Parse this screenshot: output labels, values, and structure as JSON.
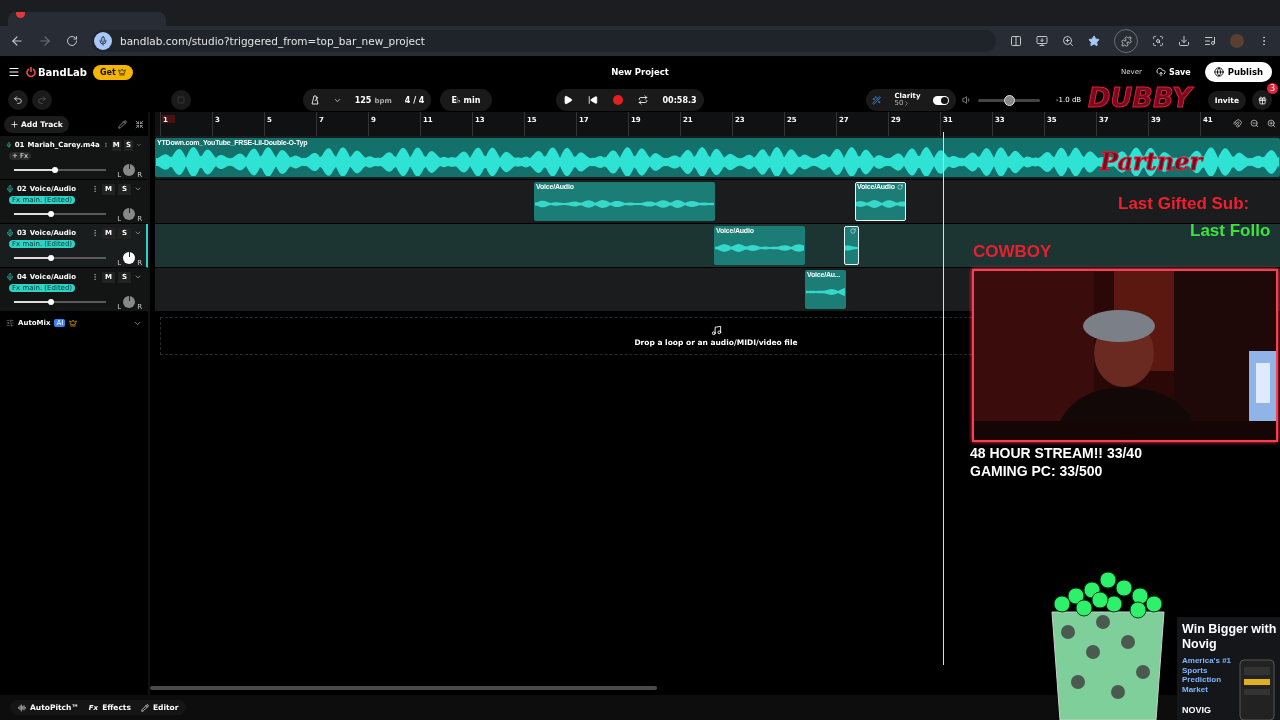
{
  "browser": {
    "url": "bandlab.com/studio?triggered_from=top_bar_new_project"
  },
  "header": {
    "brand": "BandLab",
    "get_label": "Get",
    "title": "New Project",
    "last_saved": "Never",
    "save": "Save",
    "publish": "Publish"
  },
  "toolbar": {
    "tempo": "125",
    "tempo_unit": "bpm",
    "time_signature": "4 / 4",
    "key": "E♭ min",
    "time": "00:58.3",
    "clarity_label": "Clarity",
    "clarity_value": "50",
    "clarity_on": true,
    "master": {
      "level": 0.5,
      "reading": "-1.0 dB"
    },
    "invite": "Invite",
    "gift_badge": "3"
  },
  "add_track": "Add Track",
  "ruler": {
    "bars": [
      {
        "label": "1"
      },
      {
        "label": "3"
      },
      {
        "label": "5"
      },
      {
        "label": "7"
      },
      {
        "label": "9"
      },
      {
        "label": "11"
      },
      {
        "label": "13"
      },
      {
        "label": "15"
      },
      {
        "label": "17"
      },
      {
        "label": "19"
      },
      {
        "label": "21"
      },
      {
        "label": "23"
      },
      {
        "label": "25"
      },
      {
        "label": "27"
      },
      {
        "label": "29"
      },
      {
        "label": "31"
      },
      {
        "label": "33"
      },
      {
        "label": "35"
      },
      {
        "label": "37"
      },
      {
        "label": "39"
      },
      {
        "label": "41"
      }
    ]
  },
  "tracks": [
    {
      "number": "01",
      "name": "Mariah_Carey.m4a",
      "fx": "+ Fx",
      "kind": "plain",
      "mute": "M",
      "solo": "S",
      "pan_left": "L",
      "pan_right": "R",
      "selected": false,
      "level": 0.45,
      "clips": [
        {
          "label": "YTDown.com_YouTube_FRSE-Lil-Double-O-Typ",
          "selected": false
        }
      ]
    },
    {
      "number": "02",
      "name": "Voice/Audio",
      "fx": "Fx main. (Edited)",
      "kind": "preset",
      "mute": "M",
      "solo": "S",
      "pan_left": "L",
      "pan_right": "R",
      "selected": false,
      "level": 0.4,
      "clips": [
        {
          "label": "Voice/Audio",
          "selected": false
        },
        {
          "label": "Voice/Audio",
          "selected": true
        }
      ]
    },
    {
      "number": "03",
      "name": "Voice/Audio",
      "fx": "Fx main. (Edited)",
      "kind": "preset",
      "mute": "M",
      "solo": "S",
      "pan_left": "L",
      "pan_right": "R",
      "selected": true,
      "level": 0.4,
      "clips": [
        {
          "label": "Voice/Audio",
          "selected": false
        },
        {
          "selected": true
        }
      ]
    },
    {
      "number": "04",
      "name": "Voice/Audio",
      "fx": "Fx main. (Edited)",
      "kind": "preset",
      "mute": "M",
      "solo": "S",
      "pan_left": "L",
      "pan_right": "R",
      "selected": false,
      "level": 0.4,
      "clips": [
        {
          "label": "Voice/Au...",
          "selected": false
        }
      ]
    }
  ],
  "automix": {
    "label": "AutoMix",
    "badge": "AI"
  },
  "drop_zone": "Drop a loop or an audio/MIDI/video file",
  "bottom_bar": [
    {
      "label": "AutoPitch™",
      "kind": "pitch"
    },
    {
      "label": "Effects",
      "kind": "fx",
      "glyph": "Fx"
    },
    {
      "label": "Editor",
      "kind": "edit"
    }
  ],
  "overlay": {
    "logo_top": "DUBBY",
    "logo_bottom": "Partner",
    "last_gifted": "Last Gifted Sub:",
    "last_follow": "Last Follo",
    "latest_name": "COWBOY",
    "goals": [
      "48 HOUR STREAM!! 33/40",
      "GAMING PC: 33/500"
    ],
    "ad": {
      "headline": "Win Bigger with Novig",
      "tagline": "America's #1 Sports Prediction Market",
      "brand": "NOVIG"
    }
  }
}
